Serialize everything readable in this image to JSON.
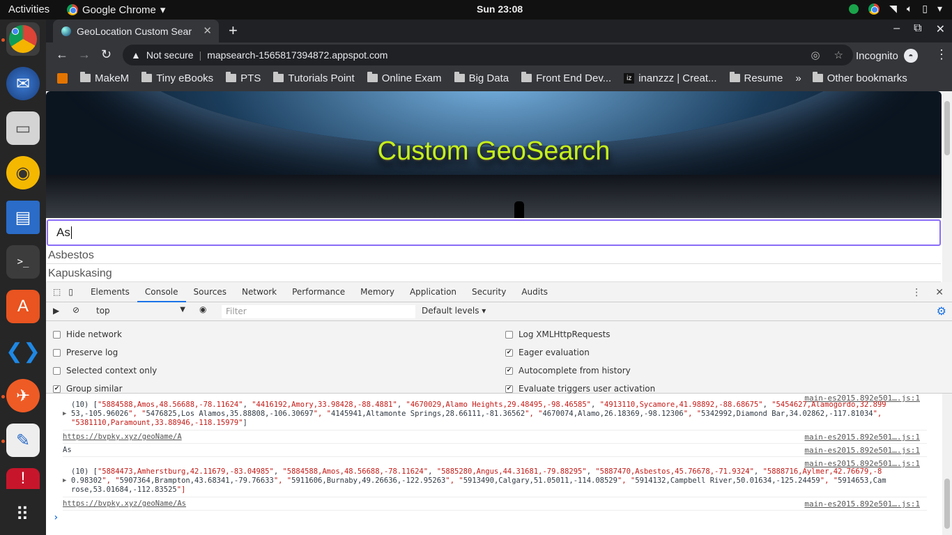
{
  "topbar": {
    "activities": "Activities",
    "app_name": "Google Chrome",
    "clock": "Sun 23:08"
  },
  "dock": {
    "apps": [
      "Chromium",
      "Thunderbird",
      "Files",
      "Rhythmbox",
      "LibreOffice Writer",
      "Terminal",
      "Ubuntu Software",
      "Visual Studio Code",
      "Postman",
      "Text Editor",
      "App",
      "Show Applications"
    ]
  },
  "browser": {
    "tab_title": "GeoLocation Custom Sear",
    "security_label": "Not secure",
    "url": "mapsearch-1565817394872.appspot.com",
    "incognito_label": "Incognito",
    "bookmarks": [
      "MakeM",
      "Tiny eBooks",
      "PTS",
      "Tutorials Point",
      "Online Exam",
      "Big Data",
      "Front End Dev...",
      "inanzzz | Creat...",
      "Resume"
    ],
    "more_bookmarks": "»",
    "other_bookmarks": "Other bookmarks"
  },
  "page": {
    "hero_title": "Custom GeoSearch",
    "search_value": "As",
    "suggestions": [
      "Asbestos",
      "Kapuskasing"
    ]
  },
  "devtools": {
    "tabs": [
      "Elements",
      "Console",
      "Sources",
      "Network",
      "Performance",
      "Memory",
      "Application",
      "Security",
      "Audits"
    ],
    "active_tab": "Console",
    "context": "top",
    "filter_placeholder": "Filter",
    "levels": "Default levels",
    "settings_left": [
      {
        "label": "Hide network",
        "checked": false
      },
      {
        "label": "Preserve log",
        "checked": false
      },
      {
        "label": "Selected context only",
        "checked": false
      },
      {
        "label": "Group similar",
        "checked": true
      }
    ],
    "settings_right": [
      {
        "label": "Log XMLHttpRequests",
        "checked": false
      },
      {
        "label": "Eager evaluation",
        "checked": true
      },
      {
        "label": "Autocomplete from history",
        "checked": true
      },
      {
        "label": "Evaluate triggers user activation",
        "checked": true
      }
    ],
    "console": {
      "source": "main-es2015.892e501….js:1",
      "entry1_line1": "(10) [\"5884588,Amos,48.56688,-78.11624\", \"4416192,Amory,33.98428,-88.4881\", \"4670029,Alamo Heights,29.48495,-98.46585\", \"4913110,Sycamore,41.98892,-88.68675\", \"5454627,Alamogordo,32.899",
      "entry1_line2": "53,-105.96026\", \"5476825,Los Alamos,35.88808,-106.30697\", \"4145941,Altamonte Springs,28.66111,-81.36562\", \"4670074,Alamo,26.18369,-98.12306\", \"5342992,Diamond Bar,34.02862,-117.81034\",",
      "entry1_line3": "\"5381110,Paramount,33.88946,-118.15979\"]",
      "link1": "https://bvpky.xyz/geoName/A",
      "log_value": "As",
      "entry2_line1": "(10) [\"5884473,Amherstburg,42.11679,-83.04985\", \"5884588,Amos,48.56688,-78.11624\", \"5885280,Angus,44.31681,-79.88295\", \"5887470,Asbestos,45.76678,-71.9324\", \"5888716,Aylmer,42.76679,-8",
      "entry2_line2": "0.98302\", \"5907364,Brampton,43.68341,-79.76633\", \"5911606,Burnaby,49.26636,-122.95263\", \"5913490,Calgary,51.05011,-114.08529\", \"5914132,Campbell River,50.01634,-125.24459\", \"5914653,Cam",
      "entry2_line3": "rose,53.01684,-112.83525\"]",
      "link2": "https://bvpky.xyz/geoName/As",
      "prompt": "›"
    }
  }
}
